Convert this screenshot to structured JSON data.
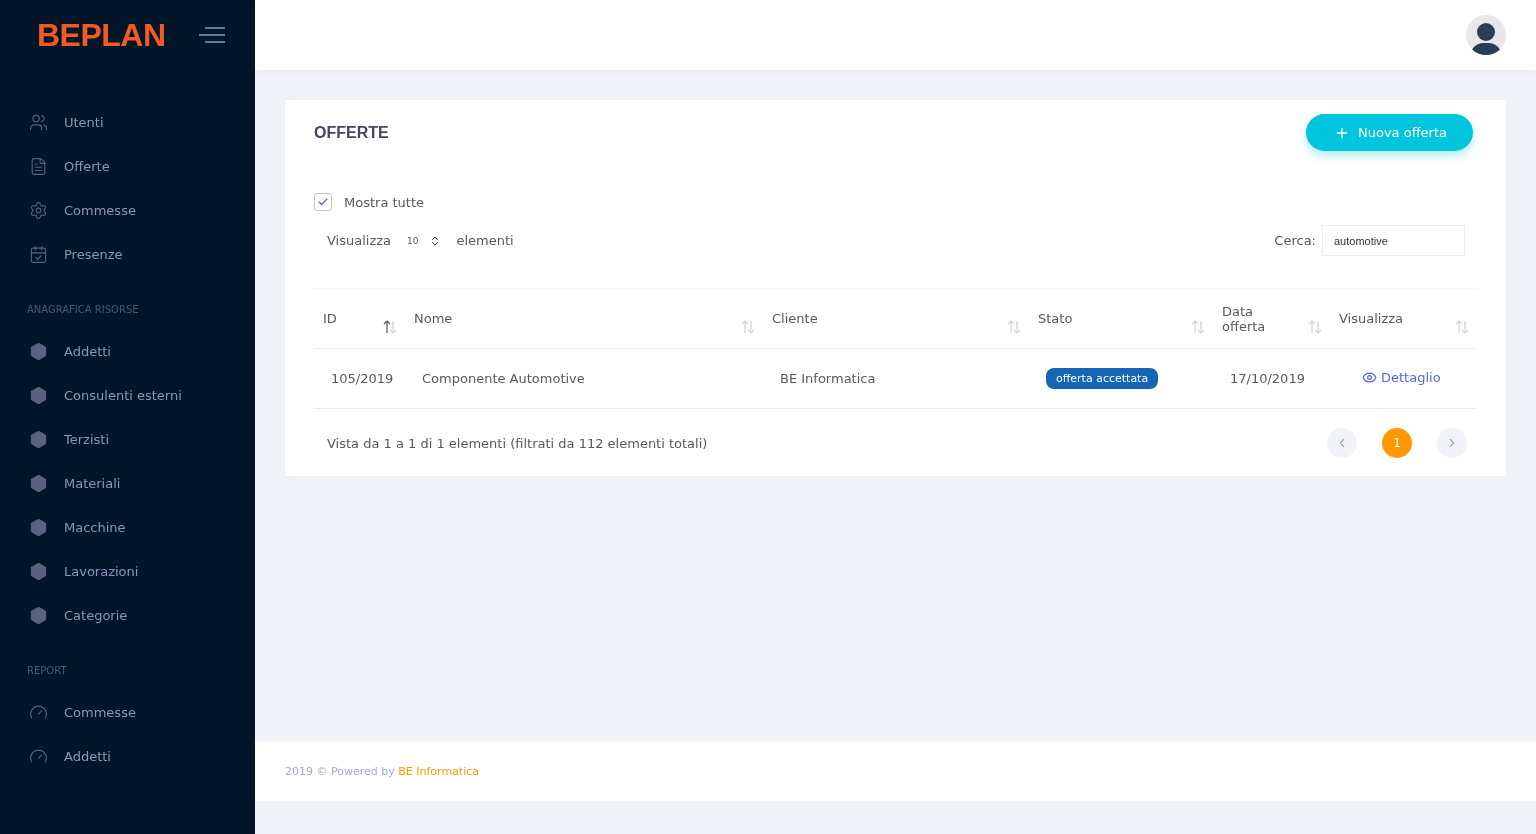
{
  "brand": {
    "logo": "BEPLAN"
  },
  "sidebar": {
    "sections": [
      {
        "items": [
          {
            "label": "Utenti"
          },
          {
            "label": "Offerte"
          },
          {
            "label": "Commesse"
          },
          {
            "label": "Presenze"
          }
        ]
      },
      {
        "heading": "ANAGRAFICA RISORSE",
        "items": [
          {
            "label": "Addetti"
          },
          {
            "label": "Consulenti esterni"
          },
          {
            "label": "Terzisti"
          },
          {
            "label": "Materiali"
          },
          {
            "label": "Macchine"
          },
          {
            "label": "Lavorazioni"
          },
          {
            "label": "Categorie"
          }
        ]
      },
      {
        "heading": "REPORT",
        "items": [
          {
            "label": "Commesse"
          },
          {
            "label": "Addetti"
          }
        ]
      }
    ]
  },
  "card": {
    "title": "OFFERTE",
    "new_button": "Nuova offerta",
    "show_all": {
      "label": "Mostra tutte",
      "checked": true
    },
    "length": {
      "before": "Visualizza",
      "value": "10",
      "after": "elementi"
    },
    "search": {
      "label": "Cerca:",
      "value": "automotive"
    },
    "table": {
      "columns": [
        {
          "label": "ID",
          "sorted": true
        },
        {
          "label": "Nome",
          "sorted": false
        },
        {
          "label": "Cliente",
          "sorted": false
        },
        {
          "label": "Stato",
          "sorted": false
        },
        {
          "label": "Data offerta",
          "sorted": false
        },
        {
          "label": "Visualizza",
          "sorted": false
        }
      ],
      "rows": [
        {
          "id": "105/2019",
          "nome": "Componente Automotive",
          "cliente": "BE Informatica",
          "stato": "offerta accettata",
          "color": "#1565b5",
          "data": "17/10/2019",
          "link": "Dettaglio"
        }
      ]
    },
    "info": "Vista da 1 a 1 di 1 elementi (filtrati da 112 elementi totali)",
    "pages": [
      {
        "label": "1",
        "selected": true
      }
    ]
  },
  "footer": {
    "text": "2019 © Powered by",
    "link": "BE Informatica"
  }
}
